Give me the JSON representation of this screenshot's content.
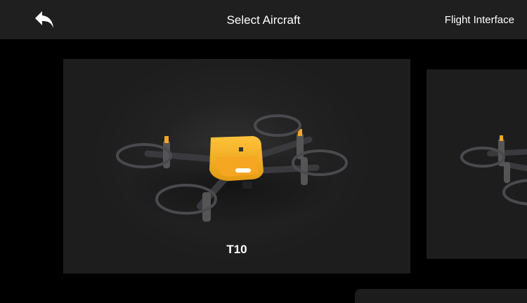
{
  "header": {
    "title": "Select Aircraft",
    "flight_interface_label": "Flight Interface",
    "back_icon": "back-arrow-icon"
  },
  "aircraft": [
    {
      "label": "T10",
      "color": "#f5a623"
    },
    {
      "label": ""
    }
  ],
  "colors": {
    "background": "#000000",
    "header": "#1f1f1f",
    "card": "#1d1d1d",
    "accent": "#f5a623"
  }
}
